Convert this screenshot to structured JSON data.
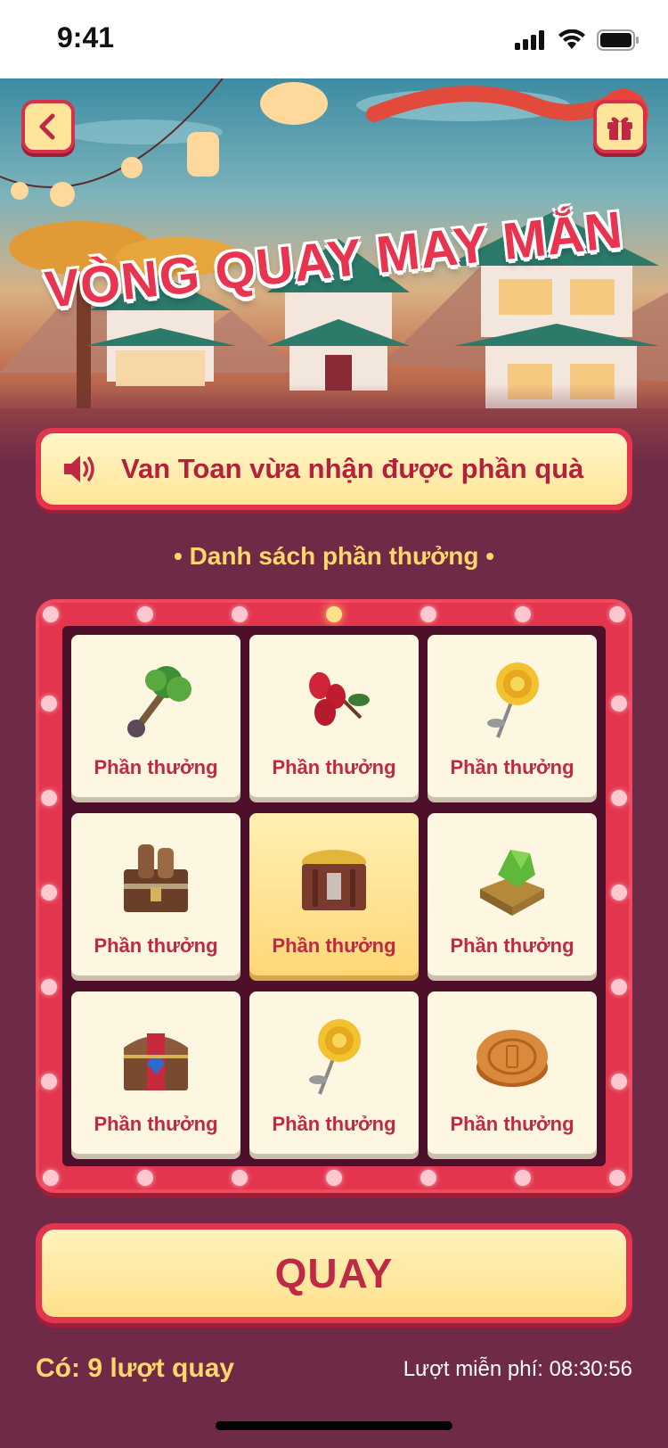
{
  "status_bar": {
    "time": "9:41"
  },
  "header": {
    "title": "VÒNG QUAY MAY MẮN",
    "back_icon": "chevron-left-icon",
    "gift_icon": "gift-icon"
  },
  "announcement": {
    "icon": "speaker-icon",
    "text": "Van Toan vừa nhận được phần quà"
  },
  "prize_list": {
    "title": "• Danh sách phần thưởng •",
    "items": [
      {
        "label": "Phần thưởng",
        "icon": "tree-icon",
        "active": false
      },
      {
        "label": "Phần thưởng",
        "icon": "berries-icon",
        "active": false
      },
      {
        "label": "Phần thưởng",
        "icon": "gold-flower-icon",
        "active": false
      },
      {
        "label": "Phần thưởng",
        "icon": "wood-chest-icon",
        "active": false
      },
      {
        "label": "Phần thưởng",
        "icon": "gold-chest-icon",
        "active": true
      },
      {
        "label": "Phần thưởng",
        "icon": "jade-stone-icon",
        "active": false
      },
      {
        "label": "Phần thưởng",
        "icon": "treasure-chest-icon",
        "active": false
      },
      {
        "label": "Phần thưởng",
        "icon": "gold-flower-icon",
        "active": false
      },
      {
        "label": "Phần thưởng",
        "icon": "mooncake-icon",
        "active": false
      }
    ]
  },
  "spin_button": {
    "label": "QUAY"
  },
  "footer": {
    "turns_text": "Có: 9 lượt quay",
    "free_timer_text": "Lượt miễn phí: 08:30:56"
  },
  "colors": {
    "background": "#6e2a47",
    "accent_red": "#e4354e",
    "cream": "#fdf7e2",
    "gold_text": "#ffd76b"
  }
}
